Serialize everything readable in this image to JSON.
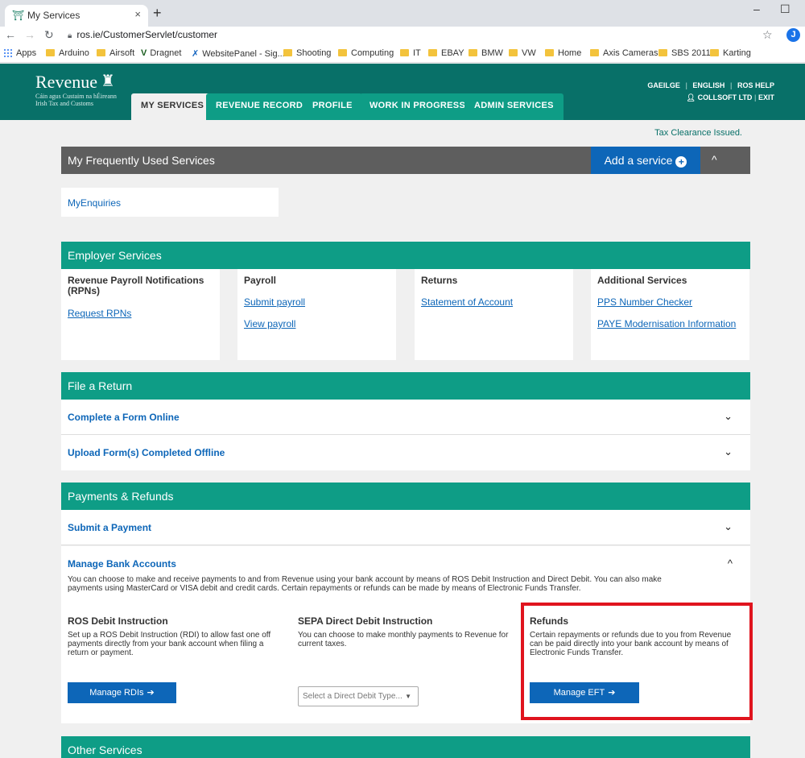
{
  "browser": {
    "tab_title": "My Services",
    "tab_close": "×",
    "new_tab": "+",
    "win_minimize": "–",
    "win_maximize": "☐",
    "url": "ros.ie/CustomerServlet/customer",
    "profile_initial": "J",
    "bookmarks": [
      "Apps",
      "Arduino",
      "Airsoft",
      "Dragnet",
      "WebsitePanel - Sig...",
      "Shooting",
      "Computing",
      "IT",
      "EBAY",
      "BMW",
      "VW",
      "Home",
      "Axis Cameras",
      "SBS 2011",
      "Karting"
    ]
  },
  "header": {
    "logo_word": "Revenue",
    "logo_sub1": "Cáin agus Custaim na hÉireann",
    "logo_sub2": "Irish Tax and Customs",
    "nav_tabs": [
      "MY SERVICES",
      "REVENUE RECORD",
      "PROFILE",
      "WORK IN PROGRESS",
      "ADMIN SERVICES"
    ],
    "top_links": [
      "GAEILGE",
      "ENGLISH",
      "ROS HELP"
    ],
    "user": "COLLSOFT LTD",
    "exit": "EXIT"
  },
  "status": {
    "tax_clearance": "Tax Clearance Issued."
  },
  "frequent": {
    "title": "My Frequently Used Services",
    "add_service": "Add a service",
    "toggle": "^",
    "items": [
      "MyEnquiries"
    ]
  },
  "employer": {
    "title": "Employer Services",
    "cards": [
      {
        "heading": "Revenue Payroll Notifications (RPNs)",
        "links": [
          "Request RPNs"
        ]
      },
      {
        "heading": "Payroll",
        "links": [
          "Submit payroll",
          "View payroll"
        ]
      },
      {
        "heading": "Returns",
        "links": [
          "Statement of Account"
        ]
      },
      {
        "heading": "Additional Services",
        "links": [
          "PPS Number Checker",
          "PAYE Modernisation Information"
        ]
      }
    ]
  },
  "file_return": {
    "title": "File a Return",
    "rows": [
      "Complete a Form Online",
      "Upload Form(s) Completed Offline"
    ]
  },
  "payments": {
    "title": "Payments & Refunds",
    "submit_payment": "Submit a Payment",
    "manage_bank": {
      "title": "Manage Bank Accounts",
      "description": "You can choose to make and receive payments to and from Revenue using your bank account by means of ROS Debit Instruction and Direct Debit. You can also make payments using MasterCard or VISA debit and credit cards. Certain repayments or refunds can be made by means of Electronic Funds Transfer.",
      "columns": [
        {
          "heading": "ROS Debit Instruction",
          "text": "Set up a ROS Debit Instruction (RDI) to allow fast one off payments directly from your bank account when filing a return or payment.",
          "button": "Manage RDIs"
        },
        {
          "heading": "SEPA Direct Debit Instruction",
          "text": "You can choose to make monthly payments to Revenue for current taxes.",
          "select_placeholder": "Select a Direct Debit Type..."
        },
        {
          "heading": "Refunds",
          "text": "Certain repayments or refunds due to you from Revenue can be paid directly into your bank account by means of Electronic Funds Transfer.",
          "button": "Manage EFT"
        }
      ]
    }
  },
  "other": {
    "title": "Other Services"
  },
  "icons": {
    "chevron_down": "⌄",
    "chevron_up": "^",
    "arrow_right": "➔",
    "plus": "+",
    "caret": "▼",
    "lock": "🔒",
    "star": "☆"
  },
  "colors": {
    "teal_header": "#087068",
    "teal_section": "#0e9d86",
    "grey_bar": "#5e5e5e",
    "blue_button": "#0d66b8",
    "highlight_red": "#e0141e"
  }
}
